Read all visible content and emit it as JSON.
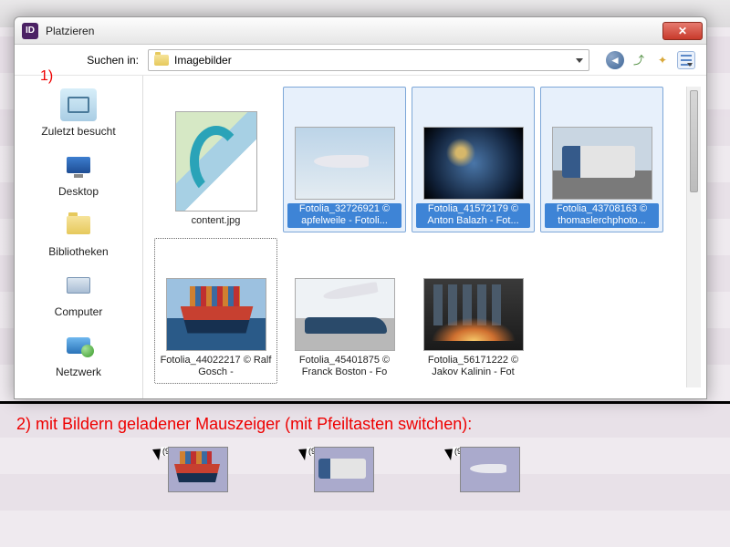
{
  "dialog": {
    "app_badge": "ID",
    "title": "Platzieren",
    "search_label": "Suchen in:",
    "folder_name": "Imagebilder"
  },
  "annotations": {
    "one": "1)",
    "two": "2) mit Bildern geladener Mauszeiger (mit Pfeiltasten switchen):"
  },
  "sidebar": {
    "items": [
      {
        "label": "Zuletzt besucht",
        "icon": "recent"
      },
      {
        "label": "Desktop",
        "icon": "desktop"
      },
      {
        "label": "Bibliotheken",
        "icon": "libs"
      },
      {
        "label": "Computer",
        "icon": "comp"
      },
      {
        "label": "Netzwerk",
        "icon": "net"
      }
    ]
  },
  "files": [
    {
      "name": "content.jpg",
      "thumb": "map",
      "tall": true,
      "selected": false
    },
    {
      "name": "Fotolia_32726921 © apfelweile - Fotoli...",
      "thumb": "plane",
      "selected": true
    },
    {
      "name": "Fotolia_41572179 © Anton Balazh - Fot...",
      "thumb": "earth",
      "selected": true
    },
    {
      "name": "Fotolia_43708163 © thomaslerchphoto...",
      "thumb": "truck",
      "selected": true
    },
    {
      "name": "Fotolia_44022217 © Ralf Gosch - ",
      "thumb": "ship",
      "focused": true
    },
    {
      "name": "Fotolia_45401875 © Franck Boston - Fo",
      "thumb": "cargo"
    },
    {
      "name": "Fotolia_56171222 © Jakov Kalinin - Fot",
      "thumb": "city"
    }
  ],
  "cursors": {
    "badge": "(9)",
    "items": [
      {
        "thumb": "ship"
      },
      {
        "thumb": "truck"
      },
      {
        "thumb": "plane"
      }
    ]
  }
}
